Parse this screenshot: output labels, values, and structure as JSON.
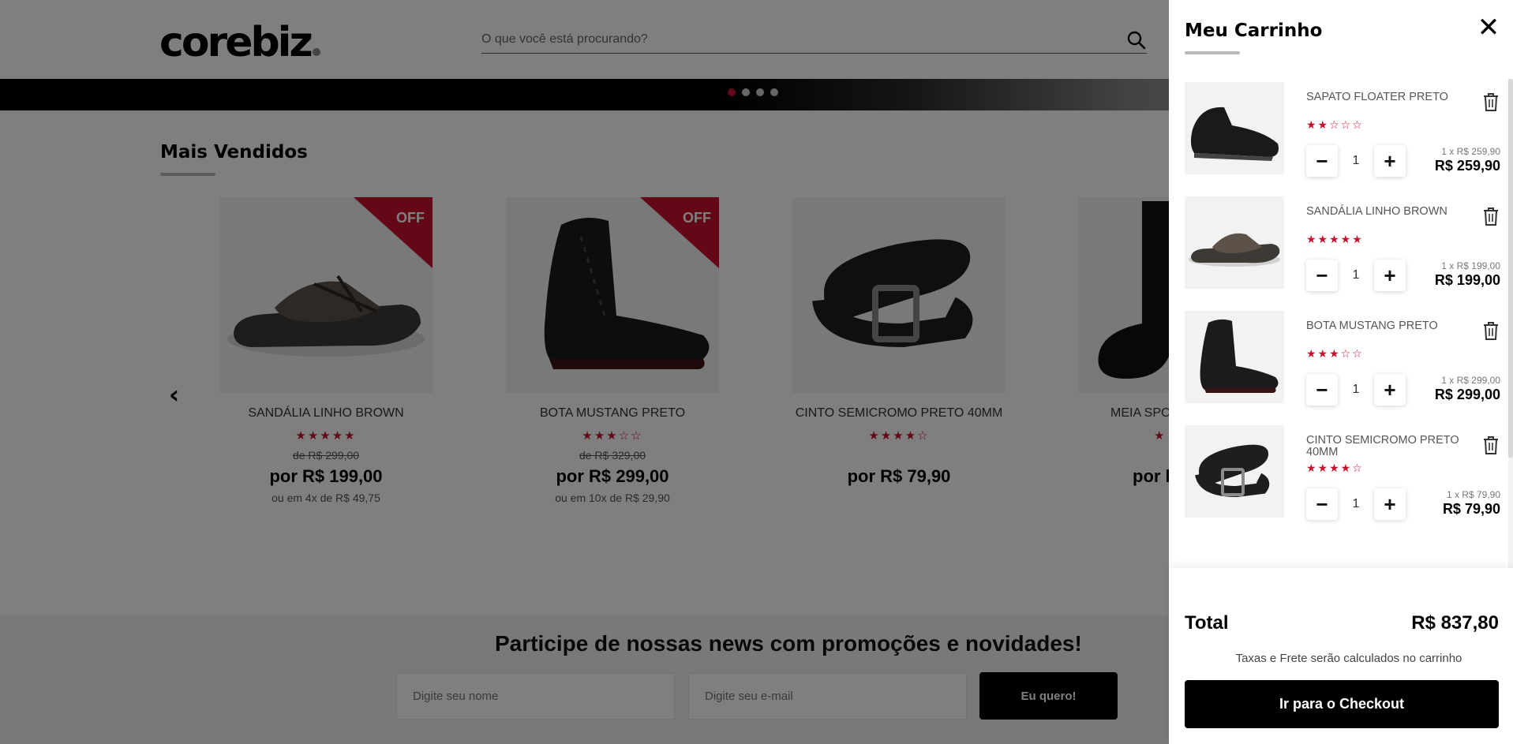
{
  "header": {
    "logo_text": "corebiz",
    "search_placeholder": "O que você está procurando?"
  },
  "banner": {
    "dots": 4,
    "active_dot": 1
  },
  "section": {
    "title": "Mais Vendidos"
  },
  "products": [
    {
      "name": "SANDÁLIA LINHO BROWN",
      "rating": 5,
      "stars": "★★★★★",
      "off": "OFF",
      "list_price": "de R$ 299,00",
      "price": "por R$ 199,00",
      "installments": "ou em 4x de R$ 49,75"
    },
    {
      "name": "BOTA MUSTANG PRETO",
      "rating": 3,
      "stars": "★★★☆☆",
      "off": "OFF",
      "list_price": "de R$ 329,00",
      "price": "por R$ 299,00",
      "installments": "ou em 10x de R$ 29,90"
    },
    {
      "name": "CINTO SEMICROMO PRETO 40MM",
      "rating": 4,
      "stars": "★★★★☆",
      "off": "",
      "list_price": "",
      "price": "por R$ 79,90",
      "installments": ""
    },
    {
      "name": "MEIA SPO",
      "rating": 3,
      "stars": "★",
      "off": "",
      "list_price": "",
      "price": "por l",
      "installments": ""
    }
  ],
  "newsletter": {
    "title": "Participe de nossas news com promoções e novidades!",
    "name_placeholder": "Digite seu nome",
    "email_placeholder": "Digite seu e-mail",
    "button_label": "Eu quero!"
  },
  "cart": {
    "title": "Meu Carrinho",
    "close_label": "✕",
    "items": [
      {
        "name": "SAPATO FLOATER PRETO",
        "rating": 2,
        "stars": "★★☆☆☆",
        "qty": "1",
        "unit": "1 x R$ 259,90",
        "total": "R$ 259,90",
        "minus": "−",
        "plus": "+"
      },
      {
        "name": "SANDÁLIA LINHO BROWN",
        "rating": 5,
        "stars": "★★★★★",
        "qty": "1",
        "unit": "1 x R$ 199,00",
        "total": "R$ 199,00",
        "minus": "−",
        "plus": "+"
      },
      {
        "name": "BOTA MUSTANG PRETO",
        "rating": 3,
        "stars": "★★★☆☆",
        "qty": "1",
        "unit": "1 x R$ 299,00",
        "total": "R$ 299,00",
        "minus": "−",
        "plus": "+"
      },
      {
        "name": "CINTO SEMICROMO PRETO 40MM",
        "rating": 4,
        "stars": "★★★★☆",
        "qty": "1",
        "unit": "1 x R$ 79,90",
        "total": "R$ 79,90",
        "minus": "−",
        "plus": "+"
      }
    ],
    "total_label": "Total",
    "total_value": "R$ 837,80",
    "tax_note": "Taxas e Frete serão calculados no carrinho",
    "checkout_label": "Ir para o Checkout"
  },
  "colors": {
    "accent": "#c8102e",
    "overlay": "rgba(0,0,0,0.5)",
    "button": "#000000"
  }
}
